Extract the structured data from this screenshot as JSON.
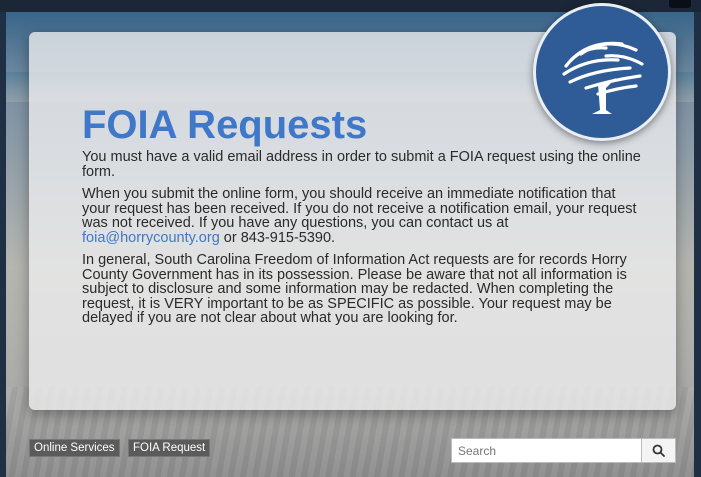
{
  "page": {
    "title": "FOIA Requests",
    "paragraphs": [
      "You must have a valid email address in order to submit a FOIA request using the online form.",
      "When you submit the online form, you should receive an immediate notification that your request has been received. If you do not receive a notification email, your request was not received. If you have any questions, you can contact us at",
      "In general, South Carolina Freedom of Information Act requests are for records Horry County Government has in its possession. Please be aware that not all information is subject to disclosure and some information may be redacted. When completing the request, it is VERY important to be as SPECIFIC as possible. Your request may be delayed if you are not clear about what you are looking for."
    ],
    "contact_email": "foia@horrycounty.org",
    "contact_or": "or",
    "contact_phone": "843-915-5390.",
    "brand_color": "#3f78c8"
  },
  "breadcrumbs": [
    "Online Services",
    "FOIA Request"
  ],
  "search": {
    "placeholder": "Search",
    "button_icon": "search-icon"
  },
  "logo": {
    "icon": "tree-logo-icon",
    "background": "#2f5c96"
  }
}
